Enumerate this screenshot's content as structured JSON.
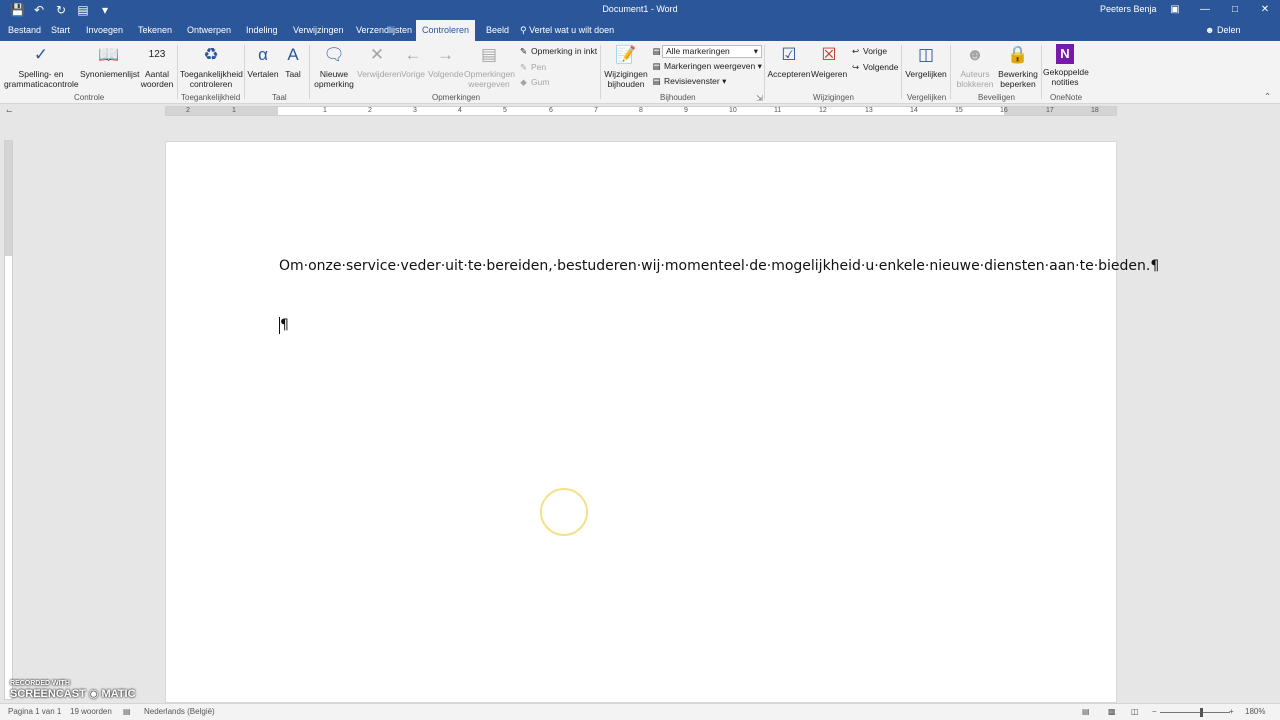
{
  "window": {
    "title": "Document1 - Word",
    "user": "Peeters Benja",
    "qat_icons": [
      "save-icon",
      "undo-icon",
      "redo-icon",
      "layout-icon",
      "customize-icon"
    ],
    "win_icons": [
      "ribbon-display-icon",
      "minimize-icon",
      "maximize-icon",
      "close-icon"
    ]
  },
  "tabs": [
    "Bestand",
    "Start",
    "Invoegen",
    "Tekenen",
    "Ontwerpen",
    "Indeling",
    "Verwijzingen",
    "Verzendlijsten",
    "Controleren",
    "Beeld"
  ],
  "active_tab": "Controleren",
  "tell_me": "Vertel wat u wilt doen",
  "share": "Delen",
  "ribbon": {
    "spelling": "Spelling- en grammaticacontrole",
    "thesaurus": "Synoniemenlijst",
    "word_count": "Aantal woorden",
    "group_controle": "Controle",
    "accessibility": "Toegankelijkheid controleren",
    "group_access": "Toegankelijkheid",
    "translate": "Vertalen",
    "language": "Taal",
    "group_taal": "Taal",
    "new_comment": "Nieuwe opmerking",
    "delete": "Verwijderen",
    "previous": "Vorige",
    "next": "Volgende",
    "show_comments": "Opmerkingen weergeven",
    "ink_comment": "Opmerking in inkt",
    "pen": "Pen",
    "eraser": "Gum",
    "group_comments": "Opmerkingen",
    "track_changes": "Wijzigingen bijhouden",
    "markup_dropdown": "Alle markeringen",
    "show_markup": "Markeringen weergeven",
    "review_pane": "Revisievenster",
    "group_tracking": "Bijhouden",
    "accept": "Accepteren",
    "reject": "Weigeren",
    "prev_change": "Vorige",
    "next_change": "Volgende",
    "group_changes": "Wijzigingen",
    "compare": "Vergelijken",
    "group_compare": "Vergelijken",
    "block_authors": "Auteurs blokkeren",
    "restrict_editing": "Bewerking beperken",
    "group_protect": "Beveiligen",
    "linked_notes": "Gekoppelde notities",
    "group_onenote": "OneNote"
  },
  "ruler_numbers": [
    "2",
    "1",
    "1",
    "2",
    "3",
    "4",
    "5",
    "6",
    "7",
    "8",
    "9",
    "10",
    "11",
    "12",
    "13",
    "14",
    "15",
    "16",
    "17",
    "18"
  ],
  "document": {
    "paragraph1": "Om·onze·service·veder·uit·te·bereiden,·bestuderen·wij·momenteel·de·mogelijkheid·u·enkele·nieuwe·diensten·aan·te·bieden.¶",
    "paragraph2": "¶"
  },
  "status": {
    "page": "Pagina 1 van 1",
    "words": "19 woorden",
    "language": "Nederlands (België)",
    "zoom": "180%",
    "zoom_level": 0.58
  },
  "watermark": {
    "top": "RECORDED WITH",
    "brand": "SCREENCAST",
    "suffix": "MATIC"
  }
}
